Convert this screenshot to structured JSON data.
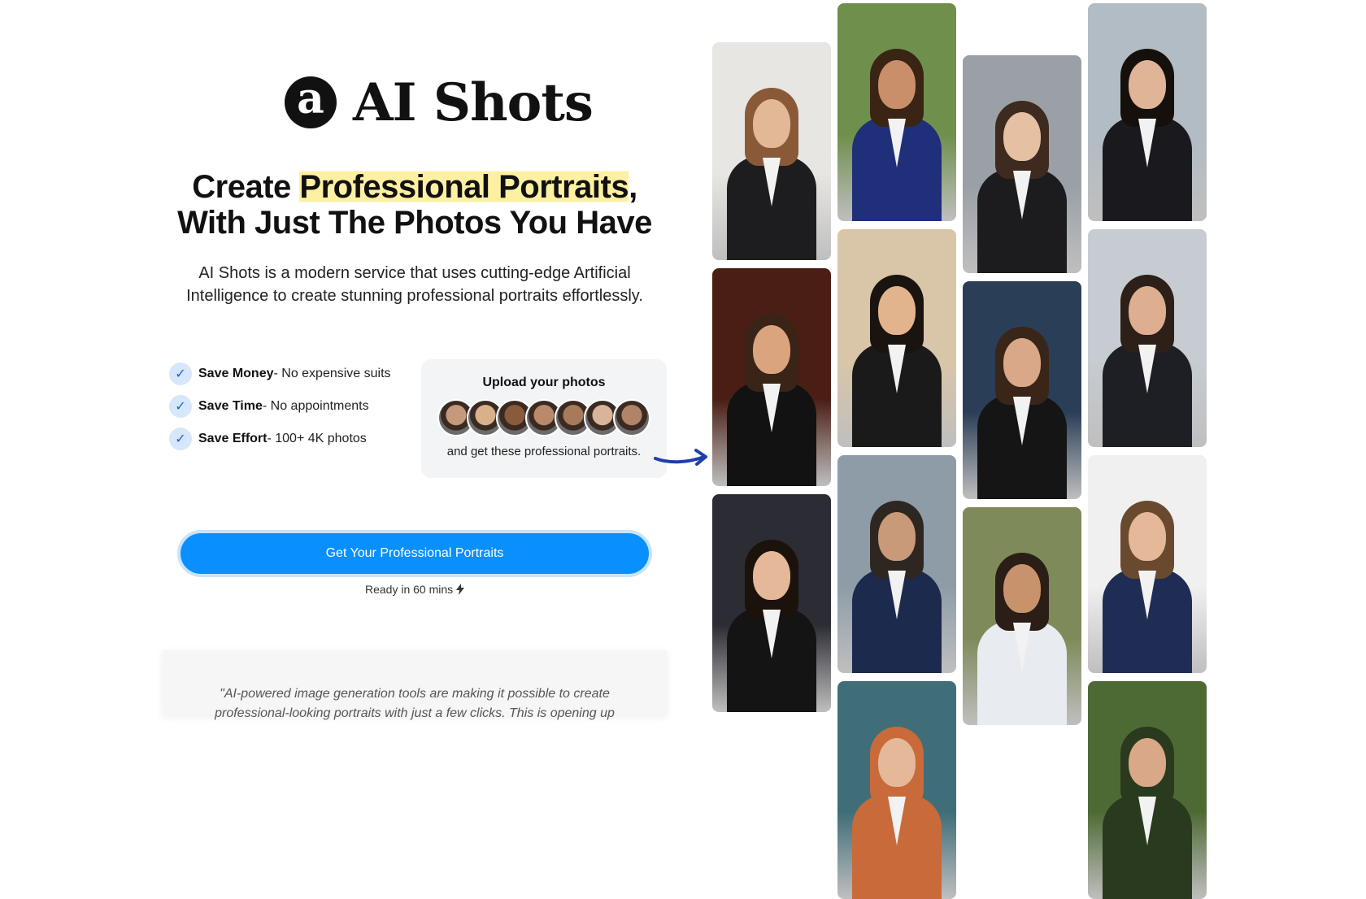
{
  "brand": {
    "logo_letter": "a",
    "name": "AI Shots"
  },
  "hero": {
    "headline_pre": "Create ",
    "headline_highlight": "Professional Portraits",
    "headline_post": ", With Just The Photos You Have",
    "description": "AI Shots is a modern service that uses cutting-edge Artificial Intelligence to create stunning professional portraits effortlessly."
  },
  "features": [
    {
      "title": "Save Money",
      "detail": " - No expensive suits"
    },
    {
      "title": "Save Time",
      "detail": " - No appointments"
    },
    {
      "title": "Save Effort",
      "detail": " - 100+ 4K photos"
    }
  ],
  "upload": {
    "title": "Upload your photos",
    "footer": "and get these professional portraits.",
    "avatar_colors": [
      "#c49a7a",
      "#d9b08c",
      "#8a5a3c",
      "#b98a6a",
      "#a87a5c",
      "#d8b49a",
      "#b08468"
    ]
  },
  "cta": {
    "label": "Get Your Professional Portraits",
    "note": "Ready in 60 mins",
    "note_icon": "lightning-icon"
  },
  "quote": {
    "text": "\"AI-powered image generation tools are making it possible to create professional-looking portraits with just a few clicks. This is opening up"
  },
  "colors": {
    "accent": "#0a8fff",
    "highlight": "#fdf0a2",
    "check_bg": "#d6e6fb",
    "arrow": "#1e3fa8"
  },
  "gallery": [
    {
      "name": "portrait-woman-seated-office",
      "bg": "#e8e6e2",
      "skin": "#e2b896",
      "suit": "#1d1d1f",
      "hair": "#8a5a38"
    },
    {
      "name": "portrait-man-tuxedo",
      "bg": "#4a1e14",
      "skin": "#d9a47e",
      "suit": "#121212",
      "hair": "#3a2418"
    },
    {
      "name": "portrait-woman-microphone",
      "bg": "#2c2c34",
      "skin": "#e4b898",
      "suit": "#141414",
      "hair": "#1c120c"
    },
    {
      "name": "portrait-woman-navy-blazer",
      "bg": "#6f8f4c",
      "skin": "#c98f6a",
      "suit": "#1f2f7a",
      "hair": "#3a2414"
    },
    {
      "name": "portrait-man-young-suit",
      "bg": "#d9c6a8",
      "skin": "#e2b48e",
      "suit": "#1a1a1a",
      "hair": "#1a1410"
    },
    {
      "name": "portrait-man-navy-suit",
      "bg": "#8e9ca8",
      "skin": "#c89a7a",
      "suit": "#1c2a4e",
      "hair": "#2e2620"
    },
    {
      "name": "portrait-woman-leather-jacket",
      "bg": "#9aa0a6",
      "skin": "#e6c0a2",
      "suit": "#1c1c1e",
      "hair": "#3e2a1e"
    },
    {
      "name": "portrait-woman-black-blazer",
      "bg": "#2a3e58",
      "skin": "#d9a888",
      "suit": "#151515",
      "hair": "#3a2618"
    },
    {
      "name": "portrait-man-white-shirt",
      "bg": "#7e8a5a",
      "skin": "#c8926c",
      "suit": "#e8ecf0",
      "hair": "#2a1e16"
    },
    {
      "name": "portrait-woman-dark-suit",
      "bg": "#b2bcc4",
      "skin": "#e0b496",
      "suit": "#1a1a1e",
      "hair": "#15100c"
    },
    {
      "name": "portrait-man-dark-suit",
      "bg": "#c6ccd2",
      "skin": "#deae90",
      "suit": "#1d1f24",
      "hair": "#2c2018"
    },
    {
      "name": "portrait-man-navy-white",
      "bg": "#f0f0f0",
      "skin": "#e4b898",
      "suit": "#1f2d55",
      "hair": "#6a4a2e"
    },
    {
      "name": "portrait-partial-red-hair",
      "bg": "#3f6d78",
      "skin": "#e4b898",
      "suit": "#c86a3a",
      "hair": "#c86a3a"
    },
    {
      "name": "portrait-partial-green",
      "bg": "#4e6a34",
      "skin": "#d9a888",
      "suit": "#2a3a1e",
      "hair": "#2a3a1e"
    }
  ]
}
